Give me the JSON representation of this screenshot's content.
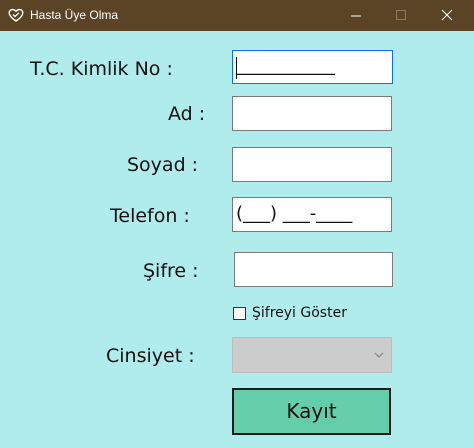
{
  "window": {
    "title": "Hasta Üye Olma",
    "app_icon": "heart-hands-icon",
    "controls": {
      "minimize_icon": "minimize-icon",
      "maximize_icon": "maximize-icon",
      "close_icon": "close-icon"
    },
    "colors": {
      "titlebar": "#5b4326",
      "background": "#b0ecec"
    }
  },
  "form": {
    "tc_label": "T.C. Kimlik No :",
    "tc_value": "___________",
    "name_label": "Ad :",
    "name_value": "",
    "surname_label": "Soyad :",
    "surname_value": "",
    "phone_label": "Telefon :",
    "phone_value": "(___) ___-____",
    "password_label": "Şifre :",
    "password_value": "",
    "show_password_label": "Şifreyi Göster",
    "show_password_checked": false,
    "gender_label": "Cinsiyet :",
    "gender_value": "",
    "submit_label": "Kayıt",
    "colors": {
      "submit_button": "#66cdaa",
      "focus_border": "#0a74d9"
    }
  }
}
